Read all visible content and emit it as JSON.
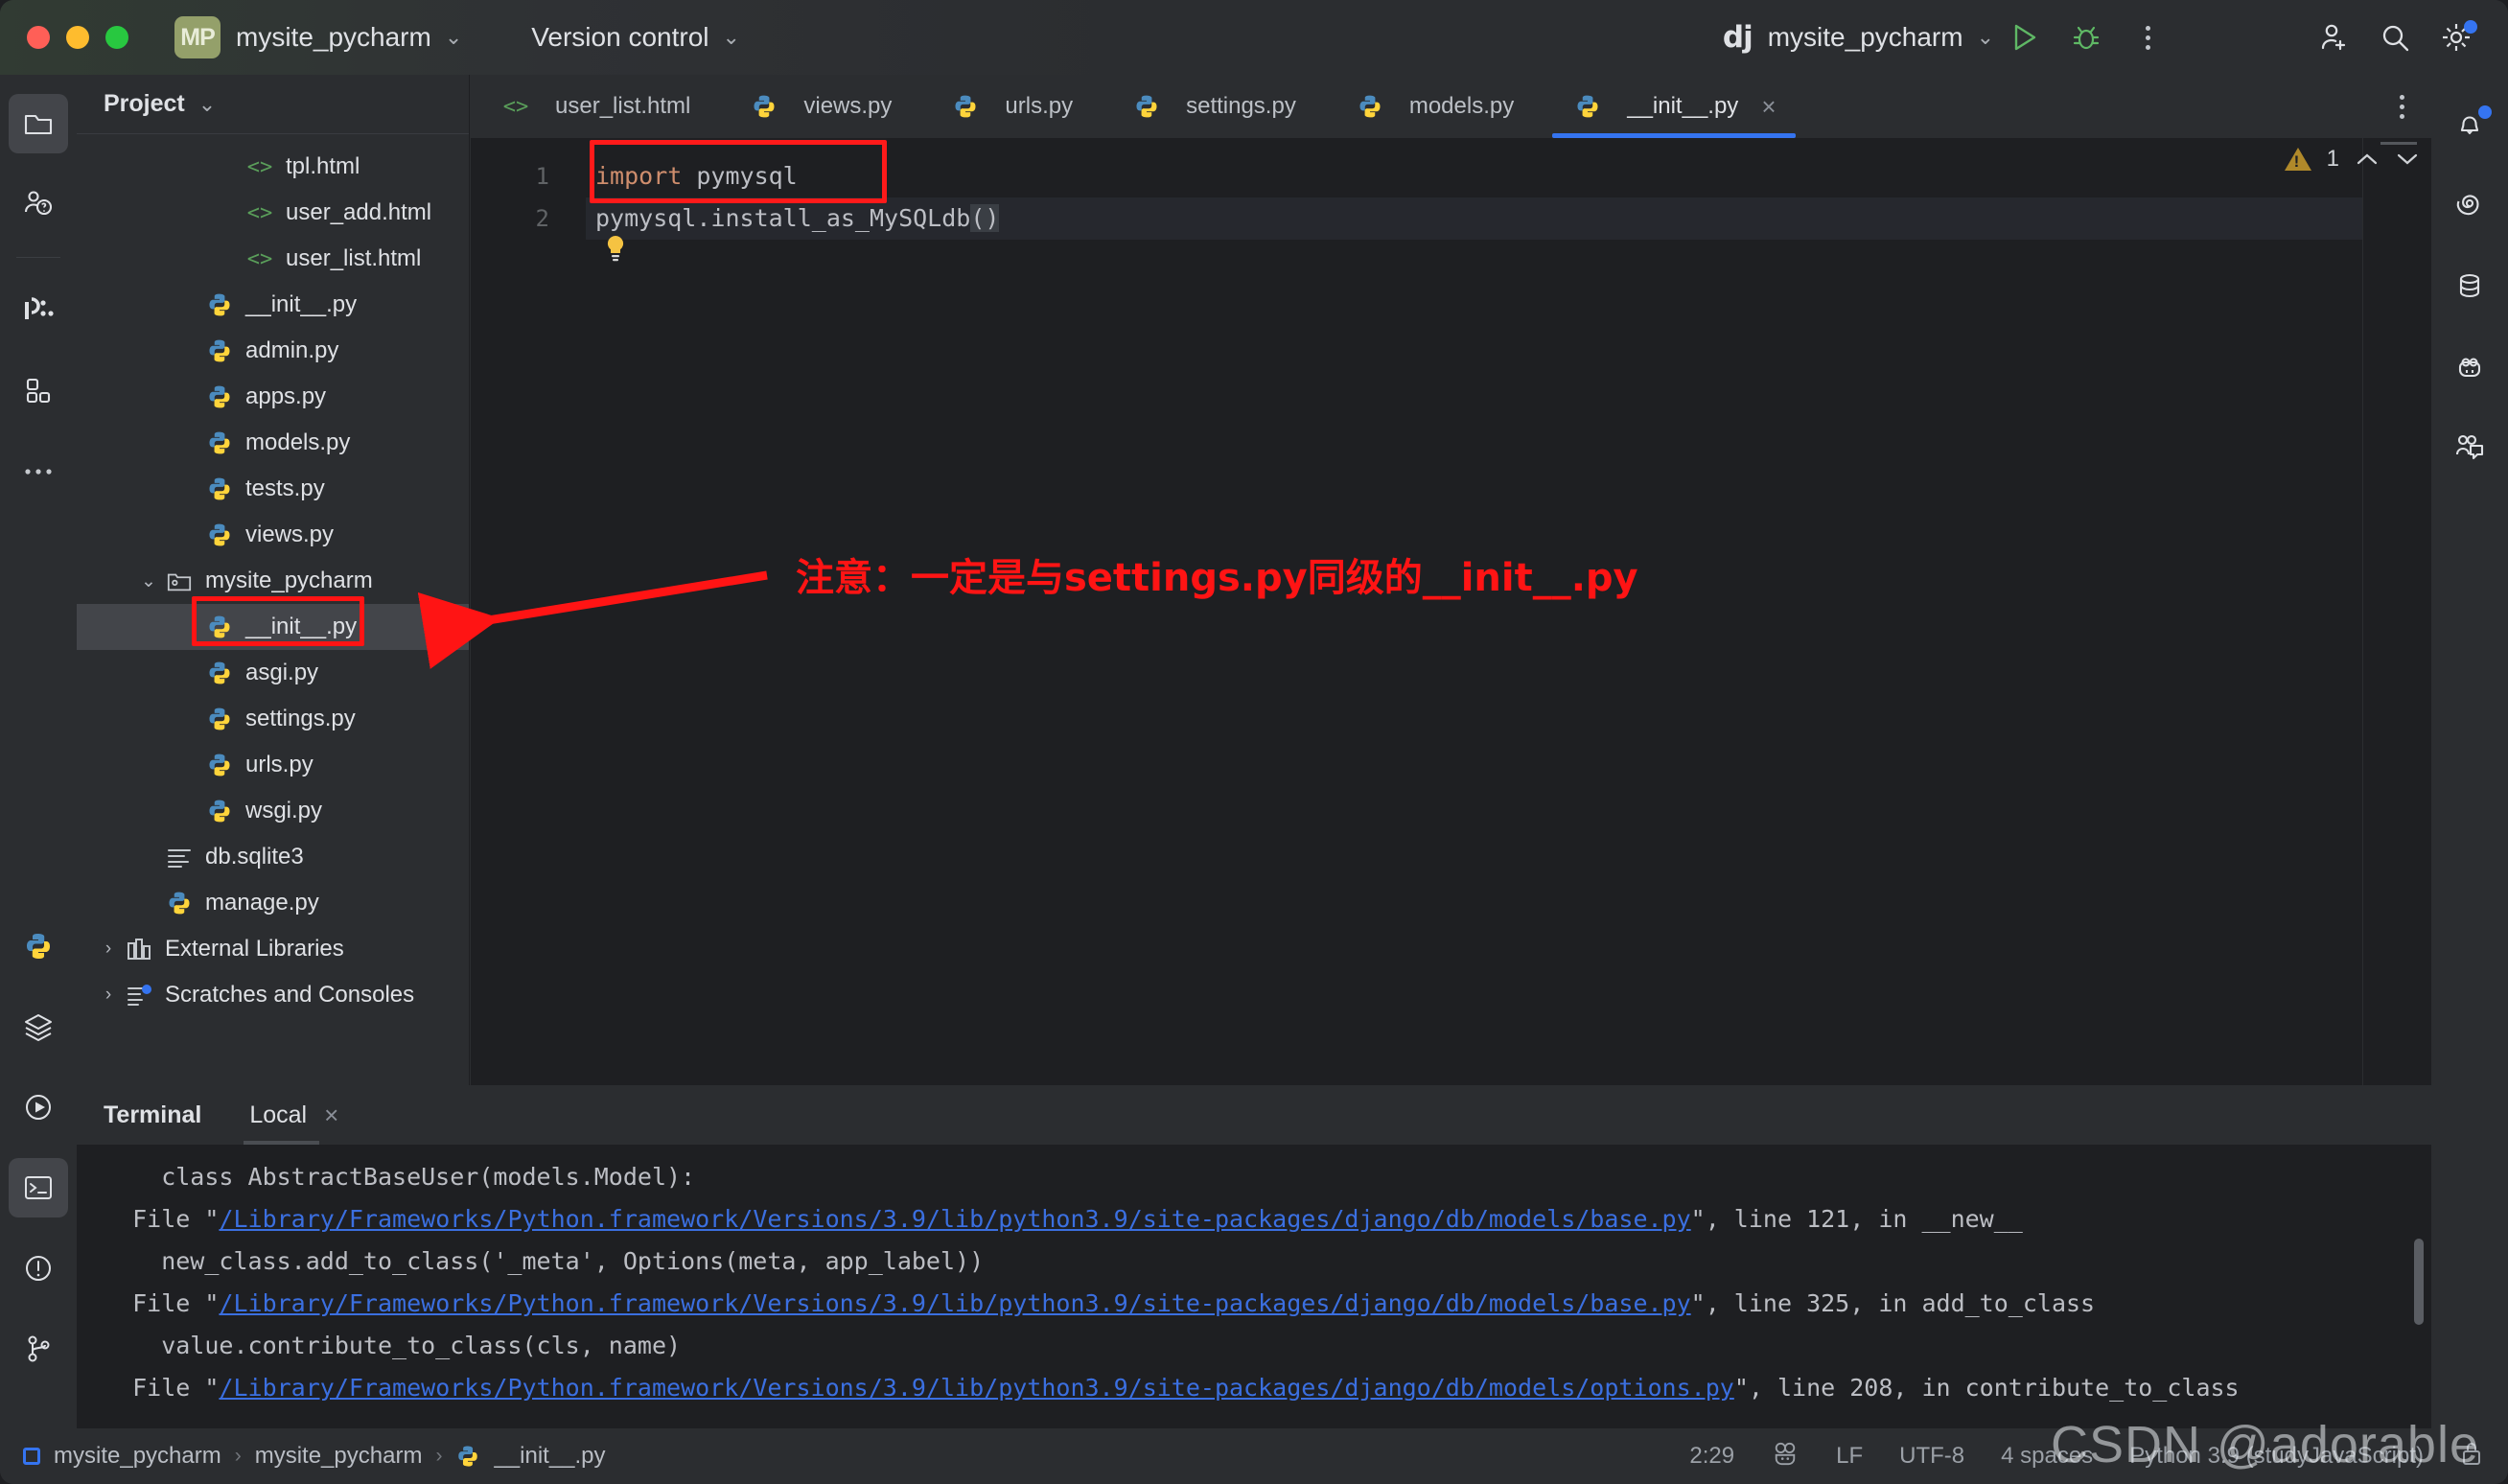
{
  "titlebar": {
    "project_badge": "MP",
    "project_name": "mysite_pycharm",
    "vcs_label": "Version control",
    "run_config": "mysite_pycharm",
    "run_icon": "run-triangle-icon",
    "debug_icon": "debug-bug-icon",
    "more_icon": "kebab-menu-icon",
    "account_icon": "add-account-icon",
    "search_icon": "search-icon",
    "settings_icon": "gear-icon"
  },
  "left_rail": {
    "items": [
      {
        "name": "project-tool-window",
        "icon": "folder-icon",
        "active": true
      },
      {
        "name": "commit-tool-window",
        "icon": "people-question-icon",
        "active": false
      },
      {
        "name": "database-tool-window",
        "icon": "dji-icon",
        "active": false
      },
      {
        "name": "structure-tool-window",
        "icon": "squares-icon",
        "active": false
      },
      {
        "name": "more-tool-windows",
        "icon": "ellipsis-icon",
        "active": false
      }
    ],
    "bottom_items": [
      {
        "name": "python-console",
        "icon": "python-icon"
      },
      {
        "name": "services-tool-window",
        "icon": "layers-icon"
      },
      {
        "name": "run-tool-window",
        "icon": "play-circle-icon"
      },
      {
        "name": "terminal-tool-window",
        "icon": "terminal-icon",
        "active": true
      },
      {
        "name": "problems-tool-window",
        "icon": "warning-circle-icon"
      },
      {
        "name": "version-control-tool-window",
        "icon": "git-branch-icon"
      }
    ]
  },
  "project_panel": {
    "title": "Project",
    "tree": [
      {
        "label": "tpl.html",
        "icon": "html-icon",
        "indent": 3,
        "arrow": "",
        "selected": false
      },
      {
        "label": "user_add.html",
        "icon": "html-icon",
        "indent": 3,
        "arrow": "",
        "selected": false
      },
      {
        "label": "user_list.html",
        "icon": "html-icon",
        "indent": 3,
        "arrow": "",
        "selected": false
      },
      {
        "label": "__init__.py",
        "icon": "python-icon",
        "indent": 2,
        "arrow": "",
        "selected": false
      },
      {
        "label": "admin.py",
        "icon": "python-icon",
        "indent": 2,
        "arrow": "",
        "selected": false
      },
      {
        "label": "apps.py",
        "icon": "python-icon",
        "indent": 2,
        "arrow": "",
        "selected": false
      },
      {
        "label": "models.py",
        "icon": "python-icon",
        "indent": 2,
        "arrow": "",
        "selected": false
      },
      {
        "label": "tests.py",
        "icon": "python-icon",
        "indent": 2,
        "arrow": "",
        "selected": false
      },
      {
        "label": "views.py",
        "icon": "python-icon",
        "indent": 2,
        "arrow": "",
        "selected": false
      },
      {
        "label": "mysite_pycharm",
        "icon": "folder-module-icon",
        "indent": 1,
        "arrow": "v",
        "selected": false
      },
      {
        "label": "__init__.py",
        "icon": "python-icon",
        "indent": 2,
        "arrow": "",
        "selected": true
      },
      {
        "label": "asgi.py",
        "icon": "python-icon",
        "indent": 2,
        "arrow": "",
        "selected": false
      },
      {
        "label": "settings.py",
        "icon": "python-icon",
        "indent": 2,
        "arrow": "",
        "selected": false
      },
      {
        "label": "urls.py",
        "icon": "python-icon",
        "indent": 2,
        "arrow": "",
        "selected": false
      },
      {
        "label": "wsgi.py",
        "icon": "python-icon",
        "indent": 2,
        "arrow": "",
        "selected": false
      },
      {
        "label": "db.sqlite3",
        "icon": "db-file-icon",
        "indent": 1,
        "arrow": "",
        "selected": false
      },
      {
        "label": "manage.py",
        "icon": "python-icon",
        "indent": 1,
        "arrow": "",
        "selected": false
      },
      {
        "label": "External Libraries",
        "icon": "library-icon",
        "indent": 0,
        "arrow": ">",
        "selected": false
      },
      {
        "label": "Scratches and Consoles",
        "icon": "scratches-icon",
        "indent": 0,
        "arrow": ">",
        "selected": false
      }
    ]
  },
  "editor": {
    "tabs": [
      {
        "label": "user_list.html",
        "icon": "html-icon",
        "active": false,
        "closable": false
      },
      {
        "label": "views.py",
        "icon": "python-icon",
        "active": false,
        "closable": false
      },
      {
        "label": "urls.py",
        "icon": "python-icon",
        "active": false,
        "closable": false
      },
      {
        "label": "settings.py",
        "icon": "python-icon",
        "active": false,
        "closable": false
      },
      {
        "label": "models.py",
        "icon": "python-icon",
        "active": false,
        "closable": false
      },
      {
        "label": "__init__.py",
        "icon": "python-icon",
        "active": true,
        "closable": true
      }
    ],
    "tab_close_glyph": "×",
    "tabs_kebab_icon": "kebab-menu-icon",
    "line_numbers": [
      "1",
      "2"
    ],
    "code_lines": [
      {
        "keyword": "import",
        "rest": " pymysql"
      },
      {
        "keyword": "",
        "rest": "pymysql.install_as_MySQLdb"
      }
    ],
    "code_paren": "()",
    "inspection_count": "1",
    "inspection_icon": "warning-triangle-icon",
    "nav_up_icon": "chevron-up-icon",
    "nav_down_icon": "chevron-down-icon",
    "bulb_icon": "lightbulb-icon"
  },
  "annotation": {
    "text": "注意：一定是与settings.py同级的__init__.py",
    "color": "#ff1414",
    "arrow_name": "red-arrow-annotation"
  },
  "terminal": {
    "title": "Terminal",
    "tab_label": "Local",
    "tab_close_glyph": "×",
    "lines": [
      {
        "pre": "    class AbstractBaseUser(models.Model):",
        "link": "",
        "post": ""
      },
      {
        "pre": "  File \"",
        "link": "/Library/Frameworks/Python.framework/Versions/3.9/lib/python3.9/site-packages/django/db/models/base.py",
        "post": "\", line 121, in __new__"
      },
      {
        "pre": "    new_class.add_to_class('_meta', Options(meta, app_label))",
        "link": "",
        "post": ""
      },
      {
        "pre": "  File \"",
        "link": "/Library/Frameworks/Python.framework/Versions/3.9/lib/python3.9/site-packages/django/db/models/base.py",
        "post": "\", line 325, in add_to_class"
      },
      {
        "pre": "    value.contribute_to_class(cls, name)",
        "link": "",
        "post": ""
      },
      {
        "pre": "  File \"",
        "link": "/Library/Frameworks/Python.framework/Versions/3.9/lib/python3.9/site-packages/django/db/models/options.py",
        "post": "\", line 208, in contribute_to_class"
      }
    ]
  },
  "right_rail": {
    "items": [
      {
        "name": "notifications",
        "icon": "bell-icon",
        "badge": true
      },
      {
        "name": "ai-assistant",
        "icon": "spiral-icon",
        "badge": false
      },
      {
        "name": "database",
        "icon": "database-icon",
        "badge": false
      },
      {
        "name": "plugins",
        "icon": "plug-face-icon",
        "badge": false
      },
      {
        "name": "code-with-me",
        "icon": "people-chat-icon",
        "badge": false
      }
    ]
  },
  "status_bar": {
    "breadcrumbs": [
      "mysite_pycharm",
      "mysite_pycharm",
      "__init__.py"
    ],
    "separator": "›",
    "caret_position": "2:29",
    "line_separator": "LF",
    "encoding": "UTF-8",
    "indent": "4 spaces",
    "interpreter": "Python 3.9 (studyJavaScript)",
    "git_icon": "git-branch-icon",
    "lock_icon": "lock-icon"
  },
  "watermark": {
    "text": "CSDN @adorable"
  },
  "colors": {
    "accent_blue": "#3574f0",
    "annotation_red": "#ff1414",
    "keyword_orange": "#cf8e6d",
    "link_blue": "#3b6fe0",
    "warn_amber": "#b0892a"
  }
}
